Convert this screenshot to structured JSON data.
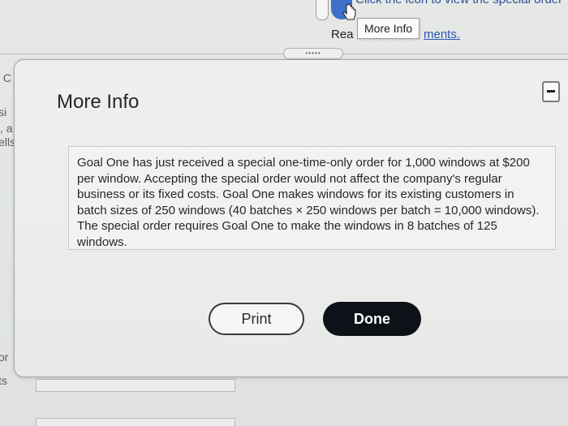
{
  "background": {
    "top_text": "Click the icon to view the special order",
    "read_label": "Rea",
    "link_label": "ments.",
    "tooltip": "More Info",
    "pill_dots": "•••••",
    "left_fragments": [
      "I C",
      "si",
      ", a",
      "ells",
      "or",
      "ts"
    ]
  },
  "modal": {
    "title": "More Info",
    "info_text": "Goal One has just received a special one-time-only order for 1,000 windows at $200 per window. Accepting the special order would not affect the company's regular business or its fixed costs. Goal One makes windows for its existing customers in batch sizes of 250 windows (40 batches × 250 windows per batch = 10,000 windows). The special order requires Goal One to make the windows in 8 batches of 125 windows.",
    "print_label": "Print",
    "done_label": "Done"
  }
}
